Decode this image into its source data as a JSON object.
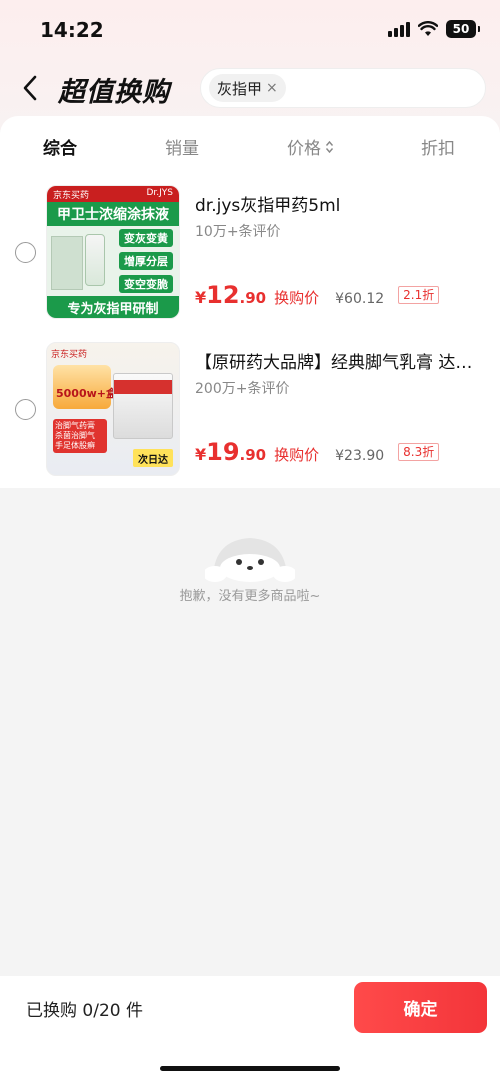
{
  "status_bar": {
    "time": "14:22",
    "battery": "50"
  },
  "header": {
    "title": "超值换购",
    "search_chip": "灰指甲",
    "chip_close": "×"
  },
  "sort_tabs": [
    {
      "label": "综合",
      "active": true
    },
    {
      "label": "销量",
      "active": false
    },
    {
      "label": "价格",
      "active": false
    },
    {
      "label": "折扣",
      "active": false
    }
  ],
  "products": [
    {
      "title": "dr.jys灰指甲药5ml",
      "reviews": "10万+条评价",
      "price_symbol": "¥",
      "price_int": "12",
      "price_dec": ".90",
      "price_label": "换购价",
      "original_price": "¥60.12",
      "discount": "2.1折",
      "image": {
        "store": "京东买药",
        "brand": "Dr.JYS",
        "headline": "甲卫士浓缩涂抹液",
        "tags": [
          "变灰变黄",
          "增厚分层",
          "变空变脆"
        ],
        "footer": "专为灰指甲研制"
      }
    },
    {
      "title": "【原研药大品牌】经典脚气乳膏 达…",
      "reviews": "200万+条评价",
      "price_symbol": "¥",
      "price_int": "19",
      "price_dec": ".90",
      "price_label": "换购价",
      "original_price": "¥23.90",
      "discount": "8.3折",
      "image": {
        "store": "京东买药",
        "promo": "5000w+盒",
        "features": "治脚气药膏 杀菌治脚气 手足体股癣",
        "delivery": "次日达"
      }
    }
  ],
  "empty_state": {
    "text": "抱歉，没有更多商品啦~"
  },
  "bottom_bar": {
    "exchanged": "已换购 0/20 件",
    "confirm": "确定"
  },
  "colors": {
    "accent": "#e8302f",
    "green": "#1b9a4a"
  }
}
